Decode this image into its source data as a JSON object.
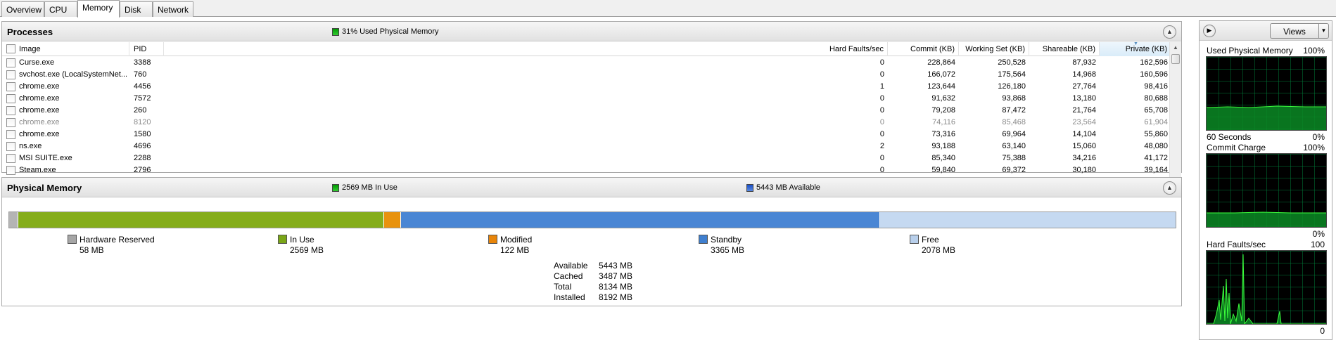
{
  "tabs": [
    "Overview",
    "CPU",
    "Memory",
    "Disk",
    "Network"
  ],
  "active_tab": "Memory",
  "processes": {
    "title": "Processes",
    "summary": "31% Used Physical Memory",
    "summary_color": "#00a000",
    "columns": [
      "Image",
      "PID",
      "Hard Faults/sec",
      "Commit (KB)",
      "Working Set (KB)",
      "Shareable (KB)",
      "Private (KB)"
    ],
    "sorted_column": "Private (KB)",
    "rows": [
      {
        "image": "Curse.exe",
        "pid": "3388",
        "hard_faults": "0",
        "commit": "228,864",
        "working_set": "250,528",
        "shareable": "87,932",
        "private": "162,596",
        "dimmed": false
      },
      {
        "image": "svchost.exe (LocalSystemNet...",
        "pid": "760",
        "hard_faults": "0",
        "commit": "166,072",
        "working_set": "175,564",
        "shareable": "14,968",
        "private": "160,596",
        "dimmed": false
      },
      {
        "image": "chrome.exe",
        "pid": "4456",
        "hard_faults": "1",
        "commit": "123,644",
        "working_set": "126,180",
        "shareable": "27,764",
        "private": "98,416",
        "dimmed": false
      },
      {
        "image": "chrome.exe",
        "pid": "7572",
        "hard_faults": "0",
        "commit": "91,632",
        "working_set": "93,868",
        "shareable": "13,180",
        "private": "80,688",
        "dimmed": false
      },
      {
        "image": "chrome.exe",
        "pid": "260",
        "hard_faults": "0",
        "commit": "79,208",
        "working_set": "87,472",
        "shareable": "21,764",
        "private": "65,708",
        "dimmed": false
      },
      {
        "image": "chrome.exe",
        "pid": "8120",
        "hard_faults": "0",
        "commit": "74,116",
        "working_set": "85,468",
        "shareable": "23,564",
        "private": "61,904",
        "dimmed": true
      },
      {
        "image": "chrome.exe",
        "pid": "1580",
        "hard_faults": "0",
        "commit": "73,316",
        "working_set": "69,964",
        "shareable": "14,104",
        "private": "55,860",
        "dimmed": false
      },
      {
        "image": "ns.exe",
        "pid": "4696",
        "hard_faults": "2",
        "commit": "93,188",
        "working_set": "63,140",
        "shareable": "15,060",
        "private": "48,080",
        "dimmed": false
      },
      {
        "image": "MSI SUITE.exe",
        "pid": "2288",
        "hard_faults": "0",
        "commit": "85,340",
        "working_set": "75,388",
        "shareable": "34,216",
        "private": "41,172",
        "dimmed": false
      },
      {
        "image": "Steam.exe",
        "pid": "2796",
        "hard_faults": "0",
        "commit": "59,840",
        "working_set": "69,372",
        "shareable": "30,180",
        "private": "39,164",
        "dimmed": false
      }
    ]
  },
  "physical_memory": {
    "title": "Physical Memory",
    "in_use_summary": "2569 MB In Use",
    "available_summary": "5443 MB Available",
    "segments": [
      {
        "name": "Hardware Reserved",
        "value": "58 MB",
        "mb": 58,
        "color": "#a6a6a6",
        "fill": "#b4b4b4"
      },
      {
        "name": "In Use",
        "value": "2569 MB",
        "mb": 2569,
        "color": "#7aa617",
        "fill": "#85ad1b"
      },
      {
        "name": "Modified",
        "value": "122 MB",
        "mb": 122,
        "color": "#e8850a",
        "fill": "#e8920e"
      },
      {
        "name": "Standby",
        "value": "3365 MB",
        "mb": 3365,
        "color": "#3f7fcf",
        "fill": "#4a86d4"
      },
      {
        "name": "Free",
        "value": "2078 MB",
        "mb": 2078,
        "color": "#b8cfeb",
        "fill": "#c5d9f1"
      }
    ],
    "stats": [
      {
        "label": "Available",
        "value": "5443 MB"
      },
      {
        "label": "Cached",
        "value": "3487 MB"
      },
      {
        "label": "Total",
        "value": "8134 MB"
      },
      {
        "label": "Installed",
        "value": "8192 MB"
      }
    ]
  },
  "side_panel": {
    "views_label": "Views",
    "graphs": [
      {
        "title": "Used Physical Memory",
        "max": "100%",
        "foot_left": "60 Seconds",
        "foot_right": "0%"
      },
      {
        "title": "Commit Charge",
        "max": "100%",
        "foot_left": "",
        "foot_right": "0%"
      },
      {
        "title": "Hard Faults/sec",
        "max": "100",
        "foot_left": "",
        "foot_right": "0"
      }
    ]
  }
}
